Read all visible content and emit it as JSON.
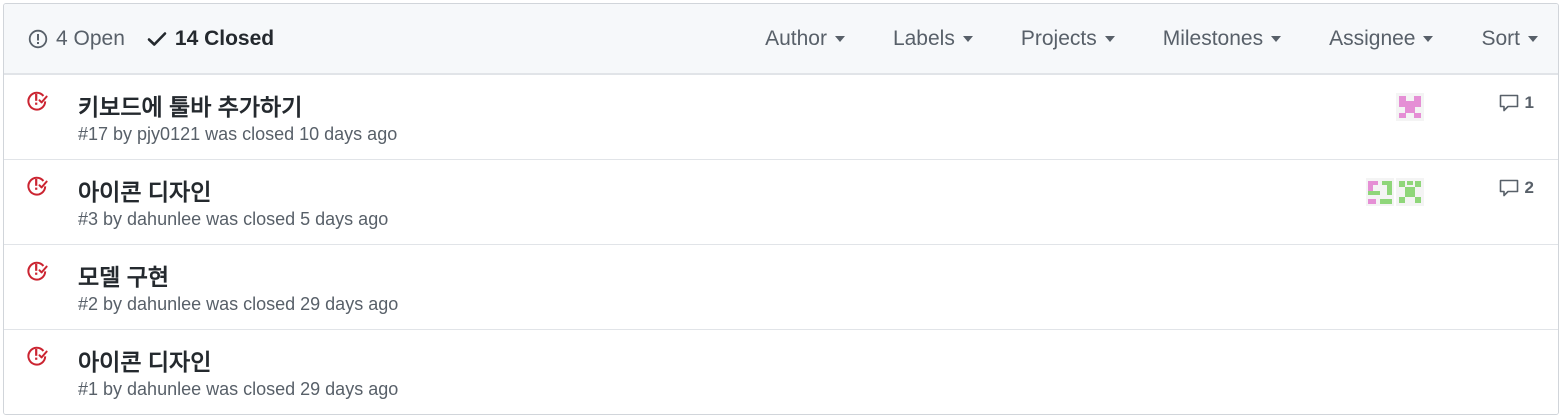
{
  "header": {
    "open_label": "4 Open",
    "closed_label": "14 Closed",
    "filters": [
      "Author",
      "Labels",
      "Projects",
      "Milestones",
      "Assignee",
      "Sort"
    ]
  },
  "issues": [
    {
      "title": "키보드에 툴바 추가하기",
      "meta": "#17 by pjy0121 was closed 10 days ago",
      "assignees": [
        "avatar-pink"
      ],
      "comments": "1"
    },
    {
      "title": "아이콘 디자인",
      "meta": "#3 by dahunlee was closed 5 days ago",
      "assignees": [
        "avatar-pink",
        "avatar-green"
      ],
      "comments": "2"
    },
    {
      "title": "모델 구현",
      "meta": "#2 by dahunlee was closed 29 days ago",
      "assignees": [],
      "comments": ""
    },
    {
      "title": "아이콘 디자인",
      "meta": "#1 by dahunlee was closed 29 days ago",
      "assignees": [],
      "comments": ""
    }
  ],
  "colors": {
    "closed_icon": "#cb2431",
    "header_bg": "#f6f8fa",
    "muted_text": "#586069",
    "avatar_pink": "#e58fd5",
    "avatar_green": "#8fd67a"
  }
}
